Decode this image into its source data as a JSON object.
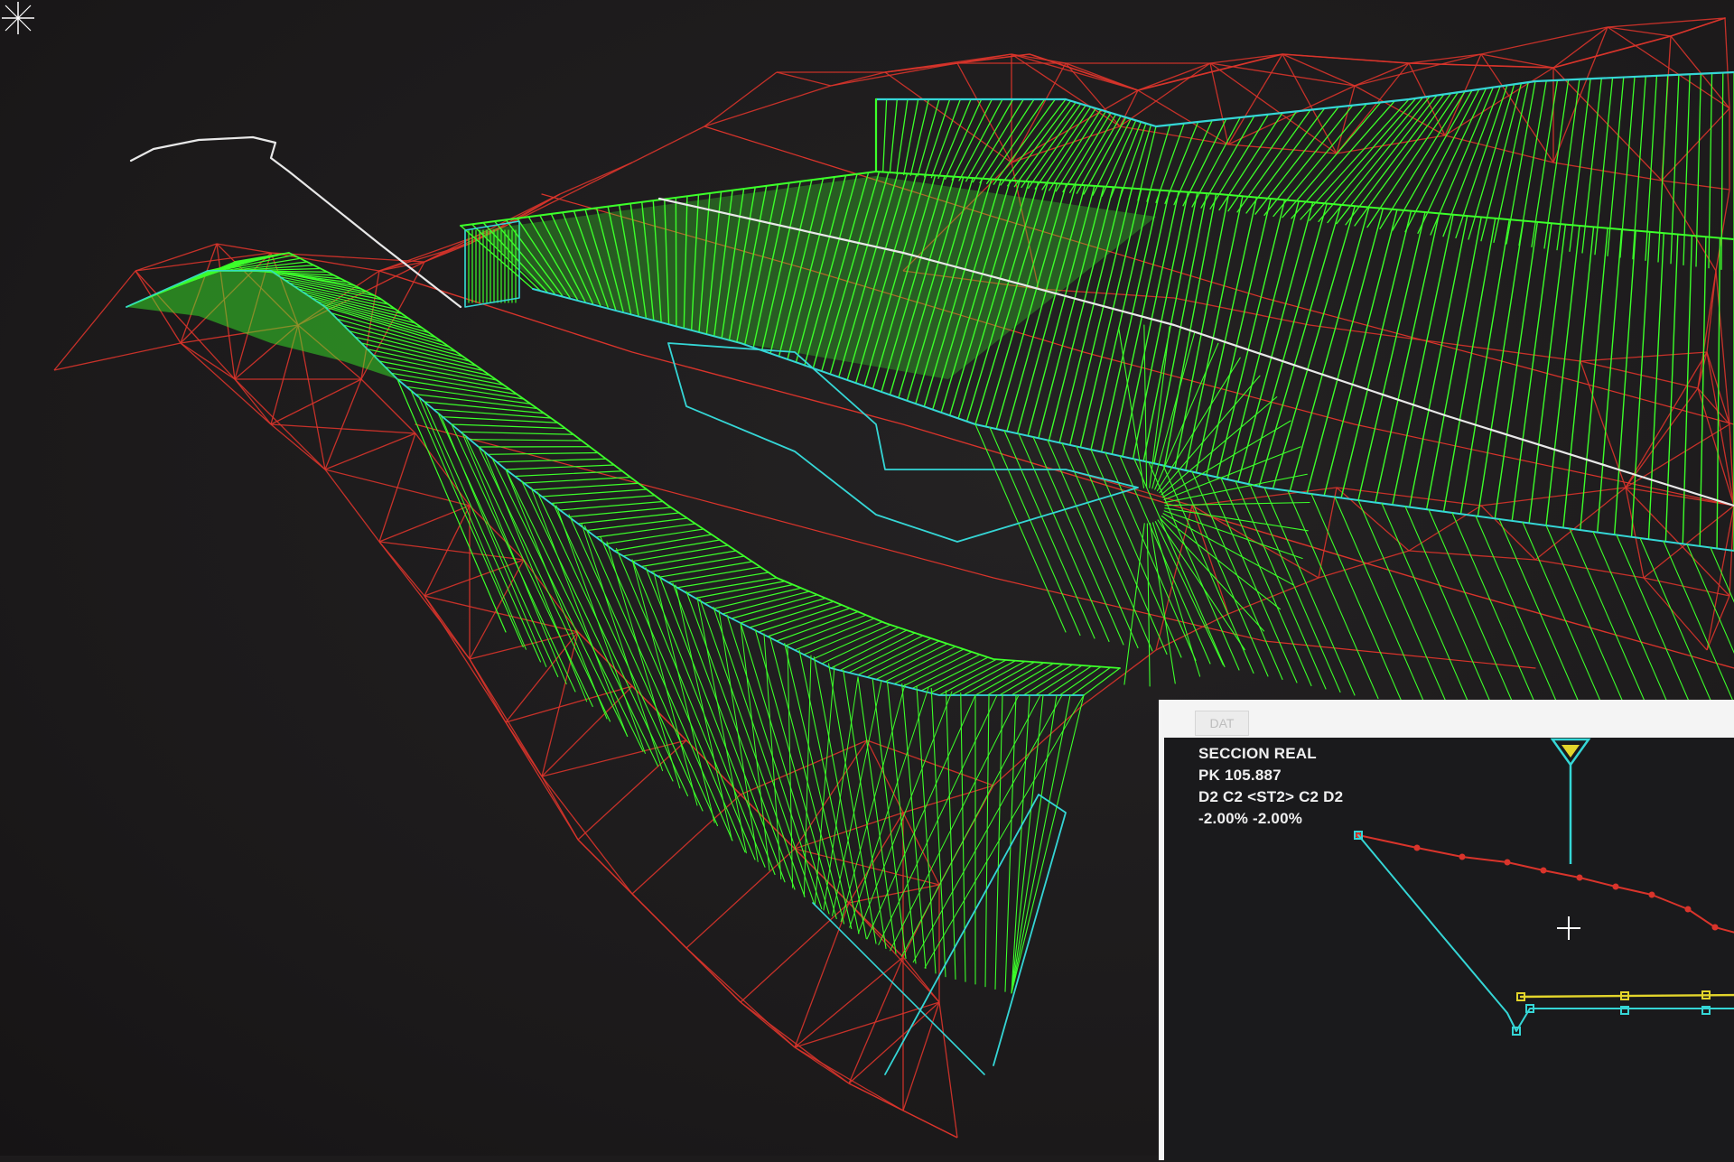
{
  "colors": {
    "background": "#1d1b1c",
    "terrain": "#d9342b",
    "design_surface": "#3cff2a",
    "boundary": "#35d6d6",
    "alignment": "#e8e8e8",
    "panel_frame": "#f2f2f2",
    "panel_body": "#1a1a1c",
    "grade_line": "#e3d52b"
  },
  "icons": {
    "cursor": "crosshair-icon",
    "level_marker": "triangle-level-icon",
    "pick_cursor": "plus-cursor-icon"
  },
  "section_panel": {
    "tab_label": "DAT",
    "title": "SECCION REAL",
    "pk": "PK 105.887",
    "codes": "D2 C2 <ST2> C2 D2",
    "slopes": "-2.00%   -2.00%"
  }
}
